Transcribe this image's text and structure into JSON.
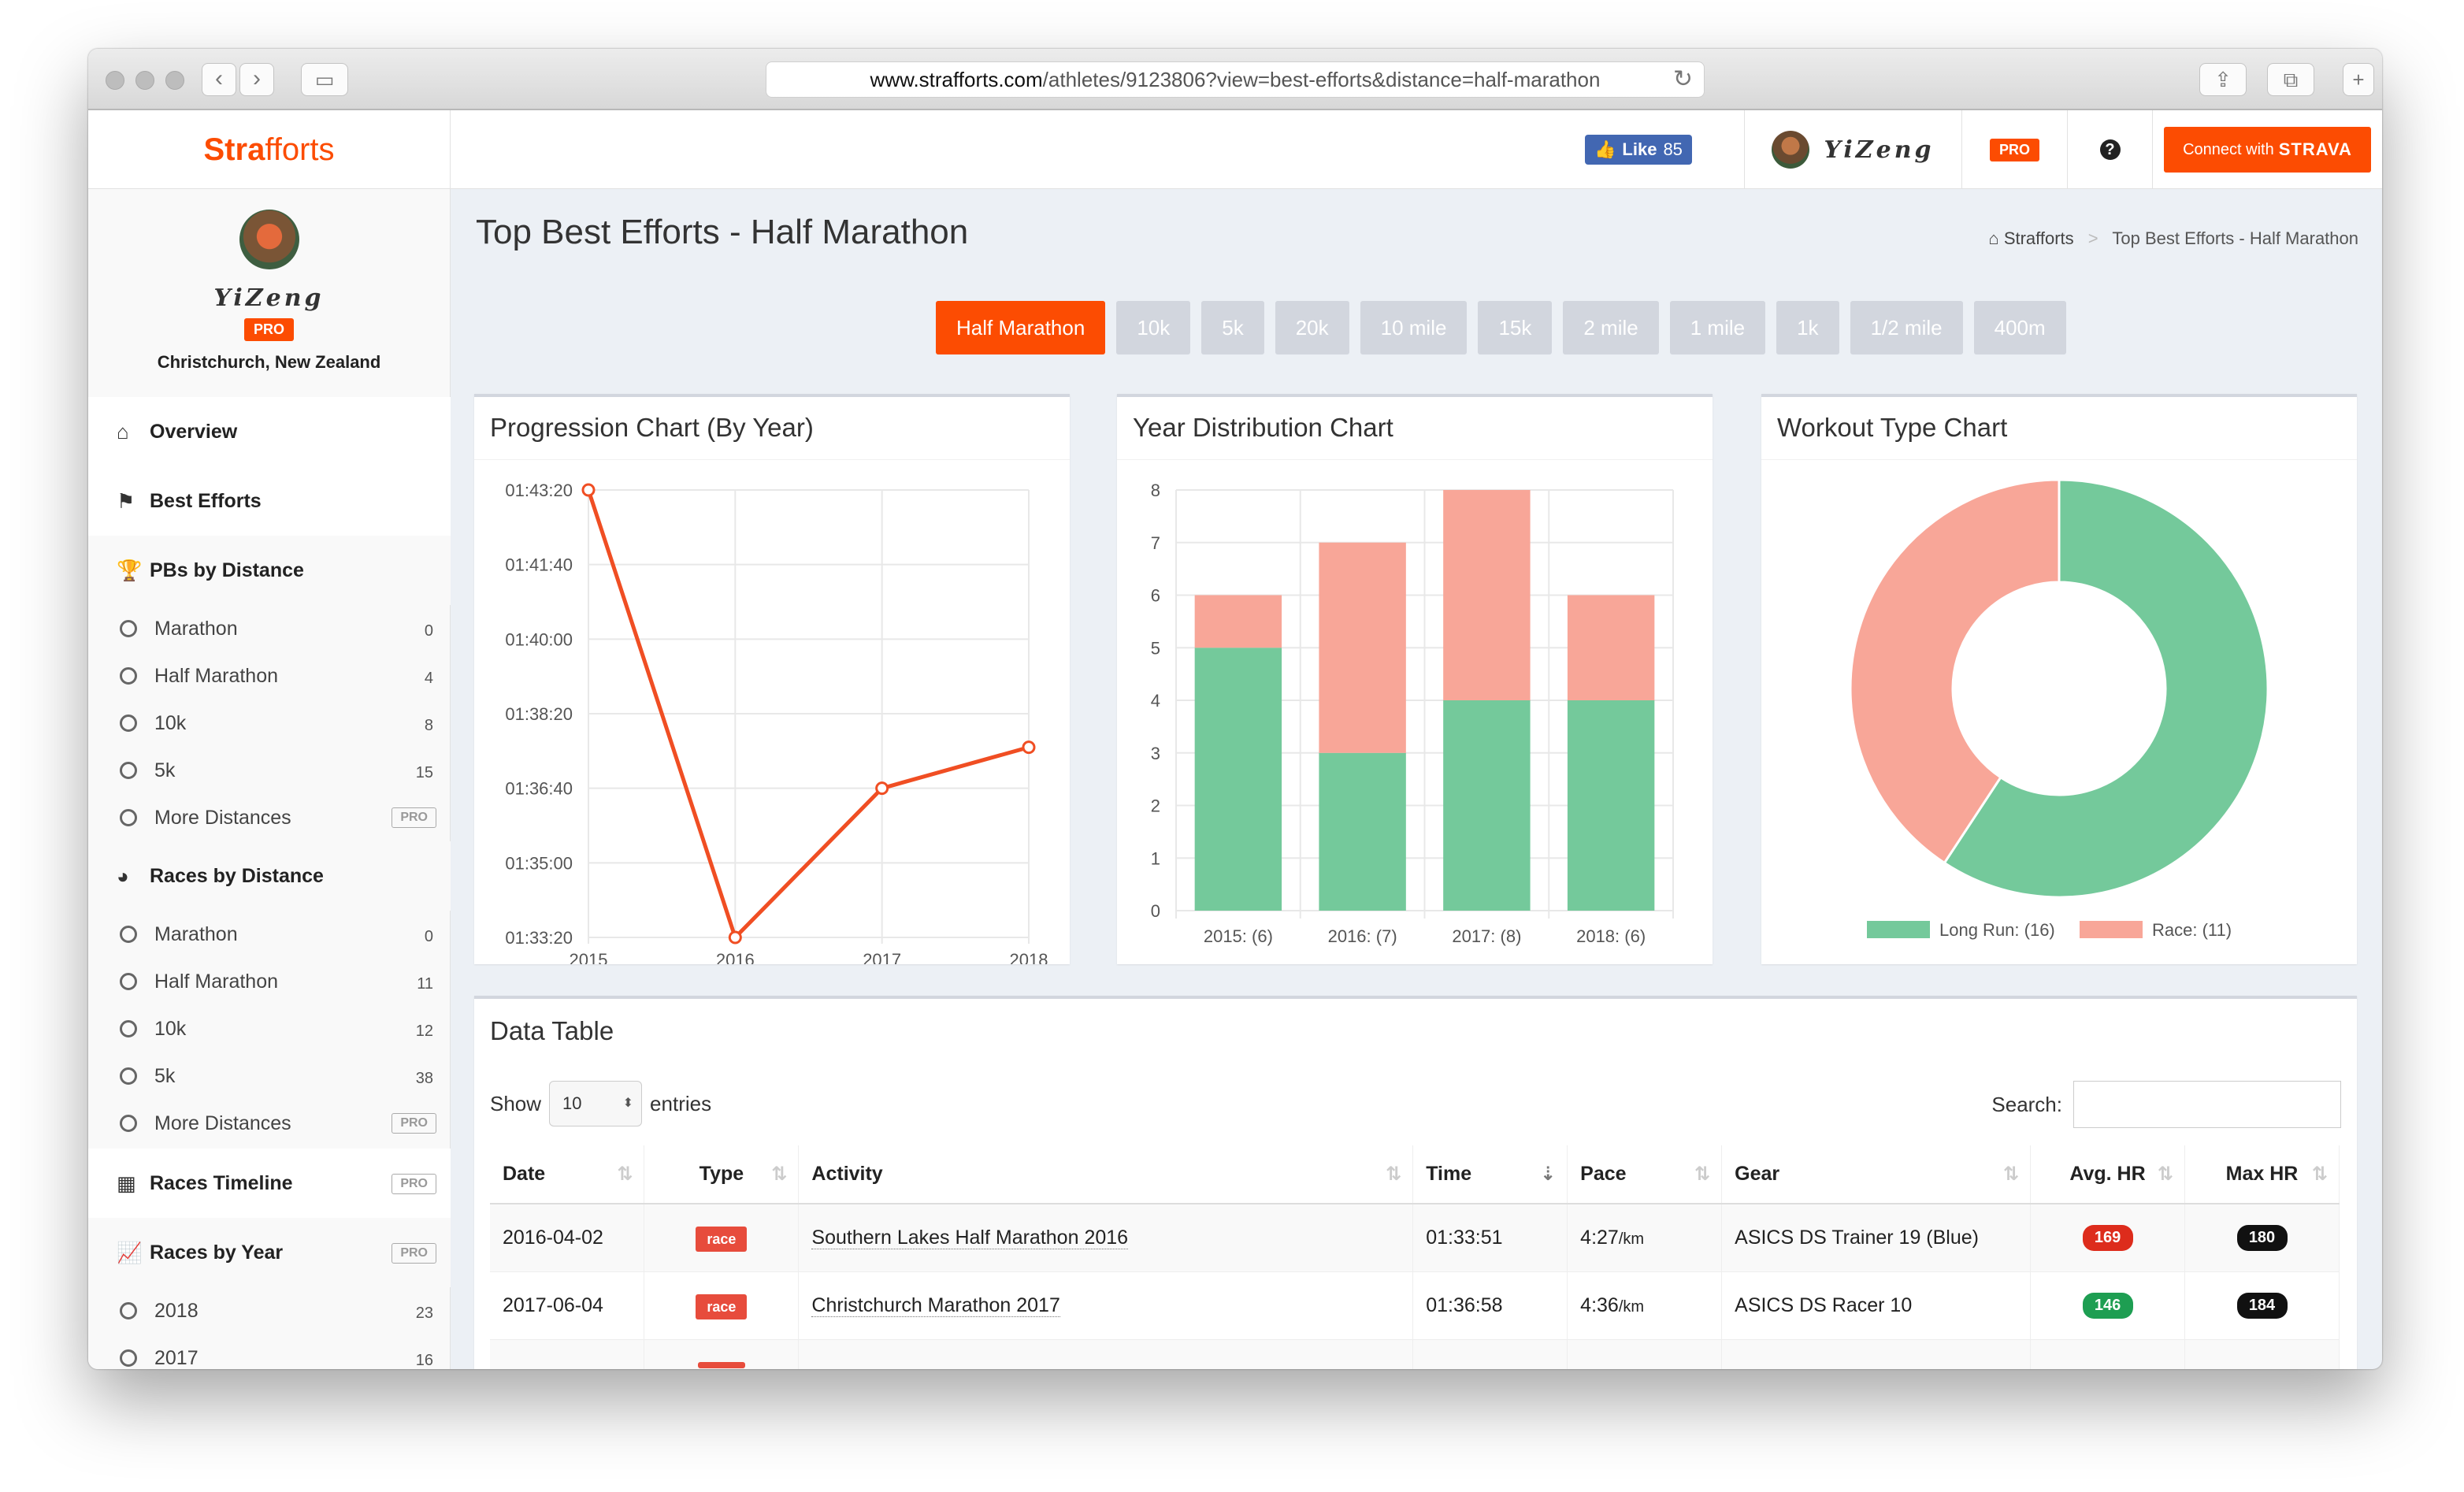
{
  "browser": {
    "url_host": "www.strafforts.com",
    "url_path": "/athletes/9123806?view=best-efforts&distance=half-marathon"
  },
  "brand": {
    "part1": "Stra",
    "part2": "fforts"
  },
  "topbar": {
    "like_label": "Like",
    "like_count": "85",
    "athlete_name": "YiZeng",
    "pro_label": "PRO",
    "help_icon": "question-circle-icon",
    "connect_label": "Connect with",
    "connect_brand": "STRAVA"
  },
  "profile": {
    "name": "YiZeng",
    "pro_label": "PRO",
    "location": "Christchurch, New Zealand"
  },
  "sidebar": {
    "overview": "Overview",
    "best_efforts": "Best Efforts",
    "pbs_by_distance": "PBs by Distance",
    "pbs_items": [
      {
        "label": "Marathon",
        "count": "0"
      },
      {
        "label": "Half Marathon",
        "count": "4"
      },
      {
        "label": "10k",
        "count": "8"
      },
      {
        "label": "5k",
        "count": "15"
      },
      {
        "label": "More Distances",
        "count": "PRO"
      }
    ],
    "races_by_distance": "Races by Distance",
    "races_items": [
      {
        "label": "Marathon",
        "count": "0"
      },
      {
        "label": "Half Marathon",
        "count": "11"
      },
      {
        "label": "10k",
        "count": "12"
      },
      {
        "label": "5k",
        "count": "38"
      },
      {
        "label": "More Distances",
        "count": "PRO"
      }
    ],
    "races_timeline": "Races Timeline",
    "races_timeline_badge": "PRO",
    "races_by_year": "Races by Year",
    "races_by_year_badge": "PRO",
    "year_items": [
      {
        "label": "2018",
        "count": "23"
      },
      {
        "label": "2017",
        "count": "16"
      }
    ]
  },
  "main": {
    "title": "Top Best Efforts - Half Marathon",
    "breadcrumb_home": "Strafforts",
    "breadcrumb_current": "Top Best Efforts - Half Marathon",
    "distance_tabs": [
      "Half Marathon",
      "10k",
      "5k",
      "20k",
      "10 mile",
      "15k",
      "2 mile",
      "1 mile",
      "1k",
      "1/2 mile",
      "400m"
    ],
    "active_tab": "Half Marathon"
  },
  "colors": {
    "accent": "#fc4c02",
    "long_run": "#74c99b",
    "race": "#f8a698",
    "line": "#f04e23"
  },
  "chart_data": [
    {
      "type": "line",
      "title": "Progression Chart (By Year)",
      "x": [
        "2015",
        "2016",
        "2017",
        "2018"
      ],
      "series": [
        {
          "values": [
            "01:43:20",
            "01:33:20",
            "01:36:40",
            "01:37:35"
          ]
        }
      ],
      "y_ticks": [
        "01:43:20",
        "01:41:40",
        "01:40:00",
        "01:38:20",
        "01:36:40",
        "01:35:00",
        "01:33:20"
      ],
      "ylim": [
        "01:33:20",
        "01:43:20"
      ]
    },
    {
      "type": "bar",
      "stacked": true,
      "title": "Year Distribution Chart",
      "categories": [
        "2015: (6)",
        "2016: (7)",
        "2017: (8)",
        "2018: (6)"
      ],
      "series": [
        {
          "name": "Long Run",
          "values": [
            5,
            3,
            4,
            4
          ]
        },
        {
          "name": "Race",
          "values": [
            1,
            4,
            4,
            2
          ]
        }
      ],
      "ylim": [
        0,
        8
      ]
    },
    {
      "type": "pie",
      "title": "Workout Type Chart",
      "categories": [
        "Long Run: (16)",
        "Race: (11)"
      ],
      "values": [
        16,
        11
      ]
    }
  ],
  "table": {
    "title": "Data Table",
    "show_label": "Show",
    "entries_value": "10",
    "entries_label": "entries",
    "search_label": "Search:",
    "columns": [
      "Date",
      "Type",
      "Activity",
      "Time",
      "Pace",
      "Gear",
      "Avg. HR",
      "Max HR"
    ],
    "rows": [
      {
        "date": "2016-04-02",
        "type": "race",
        "activity": "Southern Lakes Half Marathon 2016",
        "time": "01:33:51",
        "pace": "4:27",
        "pace_unit": "/km",
        "gear": "ASICS DS Trainer 19 (Blue)",
        "avg_hr": "169",
        "avg_hr_color": "#dd2c1c",
        "max_hr": "180"
      },
      {
        "date": "2017-06-04",
        "type": "race",
        "activity": "Christchurch Marathon 2017",
        "time": "01:36:58",
        "pace": "4:36",
        "pace_unit": "/km",
        "gear": "ASICS DS Racer 10",
        "avg_hr": "146",
        "avg_hr_color": "#1e9e52",
        "max_hr": "184"
      }
    ]
  }
}
